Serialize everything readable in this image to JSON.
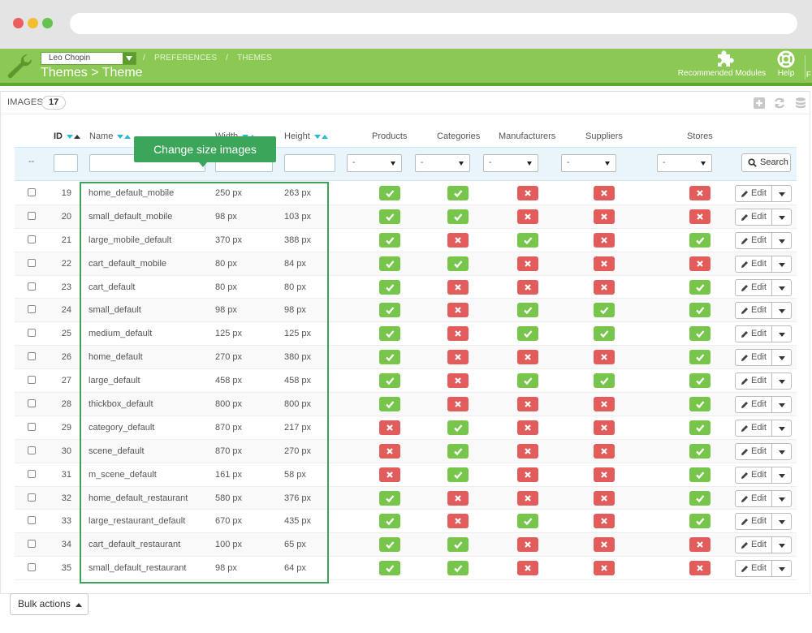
{
  "header": {
    "employee": "Leo Chopin",
    "breadcrumbs": [
      "PREFERENCES",
      "/",
      "THEMES"
    ],
    "breadcrumb_sep": "/",
    "title": "Themes > Theme",
    "recommended_label": "Recommended Modules",
    "help_label": "Help",
    "edge_letter": "F"
  },
  "panel": {
    "title": "IMAGES",
    "count": "17"
  },
  "columns": {
    "id": "ID",
    "name": "Name",
    "width": "Width",
    "height": "Height",
    "products": "Products",
    "categories": "Categories",
    "manufacturers": "Manufacturers",
    "suppliers": "Suppliers",
    "stores": "Stores"
  },
  "filters": {
    "dash": "--",
    "select_value": "-",
    "search_label": "Search"
  },
  "annotation": {
    "tooltip": "Change size images"
  },
  "edit_label": "Edit",
  "rows": [
    {
      "id": "19",
      "name": "home_default_mobile",
      "width": "250 px",
      "height": "263 px",
      "flags": [
        1,
        1,
        0,
        0,
        0
      ]
    },
    {
      "id": "20",
      "name": "small_default_mobile",
      "width": "98 px",
      "height": "103 px",
      "flags": [
        1,
        1,
        0,
        0,
        0
      ]
    },
    {
      "id": "21",
      "name": "large_mobile_default",
      "width": "370 px",
      "height": "388 px",
      "flags": [
        1,
        0,
        1,
        0,
        1
      ]
    },
    {
      "id": "22",
      "name": "cart_default_mobile",
      "width": "80 px",
      "height": "84 px",
      "flags": [
        1,
        1,
        0,
        0,
        0
      ]
    },
    {
      "id": "23",
      "name": "cart_default",
      "width": "80 px",
      "height": "80 px",
      "flags": [
        1,
        0,
        0,
        0,
        1
      ]
    },
    {
      "id": "24",
      "name": "small_default",
      "width": "98 px",
      "height": "98 px",
      "flags": [
        1,
        0,
        1,
        1,
        1
      ]
    },
    {
      "id": "25",
      "name": "medium_default",
      "width": "125 px",
      "height": "125 px",
      "flags": [
        1,
        0,
        1,
        1,
        1
      ]
    },
    {
      "id": "26",
      "name": "home_default",
      "width": "270 px",
      "height": "380 px",
      "flags": [
        1,
        0,
        0,
        0,
        1
      ]
    },
    {
      "id": "27",
      "name": "large_default",
      "width": "458 px",
      "height": "458 px",
      "flags": [
        1,
        0,
        1,
        1,
        1
      ]
    },
    {
      "id": "28",
      "name": "thickbox_default",
      "width": "800 px",
      "height": "800 px",
      "flags": [
        1,
        0,
        0,
        0,
        1
      ]
    },
    {
      "id": "29",
      "name": "category_default",
      "width": "870 px",
      "height": "217 px",
      "flags": [
        0,
        1,
        0,
        0,
        1
      ]
    },
    {
      "id": "30",
      "name": "scene_default",
      "width": "870 px",
      "height": "270 px",
      "flags": [
        0,
        1,
        0,
        0,
        1
      ]
    },
    {
      "id": "31",
      "name": "m_scene_default",
      "width": "161 px",
      "height": "58 px",
      "flags": [
        0,
        1,
        0,
        0,
        1
      ]
    },
    {
      "id": "32",
      "name": "home_default_restaurant",
      "width": "580 px",
      "height": "376 px",
      "flags": [
        1,
        0,
        0,
        0,
        1
      ]
    },
    {
      "id": "33",
      "name": "large_restaurant_default",
      "width": "670 px",
      "height": "435 px",
      "flags": [
        1,
        0,
        1,
        0,
        1
      ]
    },
    {
      "id": "34",
      "name": "cart_default_restaurant",
      "width": "100 px",
      "height": "65 px",
      "flags": [
        1,
        1,
        0,
        0,
        0
      ]
    },
    {
      "id": "35",
      "name": "small_default_restaurant",
      "width": "98 px",
      "height": "64 px",
      "flags": [
        1,
        1,
        0,
        0,
        0
      ]
    }
  ],
  "footer": {
    "bulk_label": "Bulk actions"
  },
  "colors": {
    "header_green": "#8bc954",
    "ok_badge": "#78c54c",
    "no_badge": "#e25c5c",
    "annotation_green": "#3ba559"
  }
}
